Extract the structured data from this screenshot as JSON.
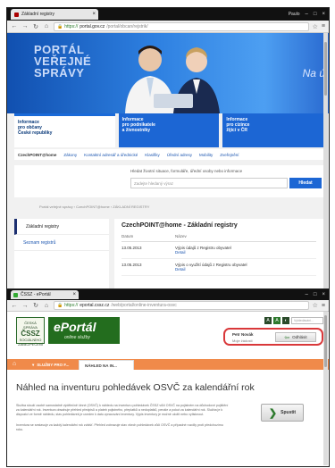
{
  "window1": {
    "tab_title": "Základní registry",
    "user_name": "Paulo",
    "url_prefix": "https://",
    "url_main": "portal.gov.cz",
    "url_rest": "/portal/obcan/rejstrik/",
    "banner_logo_lines": [
      "PORTÁL",
      "VEŘEJNÉ",
      "SPRÁVY"
    ],
    "banner_right": "Na ú",
    "info_boxes": [
      {
        "lines": [
          "Informace",
          "pro občany",
          "České republiky"
        ],
        "style": "white"
      },
      {
        "lines": [
          "Informace",
          "pro podnikatele",
          "a živnostníky"
        ],
        "style": "blue"
      },
      {
        "lines": [
          "Informace",
          "pro cizince",
          "žijící v ČR"
        ],
        "style": "blue"
      }
    ],
    "topnav": [
      "CzechPOINT@home",
      "Zákony",
      "Kontaktní adresář a úřednické",
      "Klasifiky",
      "Úřední adresy",
      "Mobility",
      "Zveřejnění"
    ],
    "search_label": "Hledat životní situace, formuláře, úřední osoby nebo informace",
    "search_placeholder": "Zadejte hledaný výraz",
    "search_button": "Hledat",
    "breadcrumb": "Portál veřejné správy  ›  CzechPOINT@home  ›  ZÁKLADNÍ REGISTRY",
    "left_menu": [
      {
        "label": "Základní registry",
        "active": true
      },
      {
        "label": "Seznam registrů",
        "active": false
      }
    ],
    "content_title": "CzechPOINT@home - Základní registry",
    "table_headers": [
      "Datum",
      "Název"
    ],
    "table_rows": [
      {
        "date": "13.05.2013",
        "title": "Výpis údajů z Registru obyvatel",
        "link": "Detail"
      },
      {
        "date": "13.05.2013",
        "title": "Výpis o využití údajů z Registru obyvatel",
        "link": "Detail"
      }
    ]
  },
  "window2": {
    "tab_title": "ČSSZ - ePortál",
    "url_prefix": "https://",
    "url_main": "eportal.cssz.cz",
    "url_rest": "/web/portal/online-inventura-osvc",
    "ossz_line1": "ČESKÁ SPRÁVA",
    "ossz_big": "ČSSZ",
    "ossz_line2": "SOCIÁLNÍHO ZABEZPEČENÍ",
    "eportal_title": "ePortál",
    "eportal_sub": "online služby",
    "small_search_placeholder": "Vyhledávání...",
    "user_name": "Petr Novák",
    "user_sub": "Moje žádosti",
    "logout_button": "Odhlásit",
    "tabs": [
      "SLUŽBY PRO F...",
      "NÁHLED NA IN..."
    ],
    "page_title": "Náhled na inventuru pohledávek OSVČ za kalendářní rok",
    "paragraph1": "Služba slouží osobě samostatně výdělečně činné (OSVČ) k náhledu na inventuru pohledávek ČSSZ vůči OSVČ na pojistném na důchodové pojištění za kalendářní rok. Inventura obsahuje přehled předpisů a plateb pojistného, přeplatků a nedoplatků, penále a pokut za kalendářní rok. Služba je k dispozici ve formě náhledu, stav pohledávek je uveden k datu zpracování inventury. Výpis inventury je možné uložit nebo vytisknout.",
    "paragraph2": "Inventura se sestavuje za každý kalendářní rok zvlášť. Přehled zobrazuje stav všech pohledávek vůči OSVČ a případné rozdíly proti předchozímu roku.",
    "start_button": "Spustit"
  }
}
